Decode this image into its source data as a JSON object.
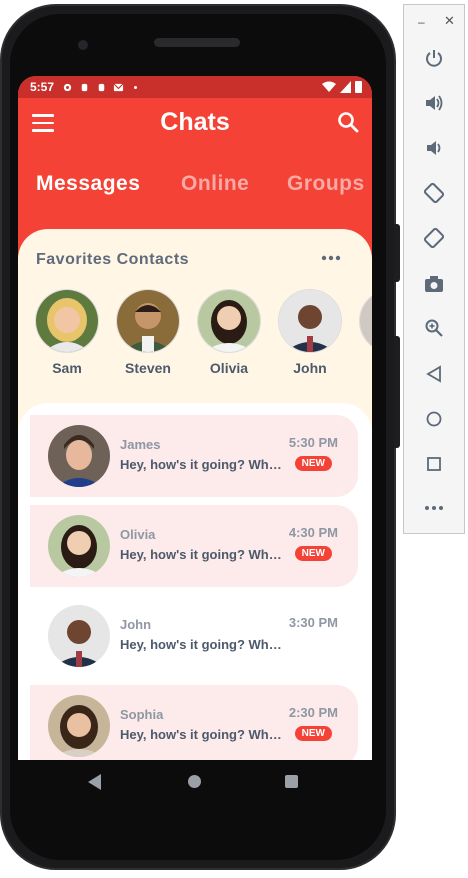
{
  "status_bar": {
    "time": "5:57"
  },
  "app_bar": {
    "title": "Chats"
  },
  "tabs": [
    {
      "label": "Messages",
      "active": true
    },
    {
      "label": "Online",
      "active": false
    },
    {
      "label": "Groups",
      "active": false
    }
  ],
  "favorites": {
    "title": "Favorites Contacts",
    "contacts": [
      {
        "name": "Sam"
      },
      {
        "name": "Steven"
      },
      {
        "name": "Olivia"
      },
      {
        "name": "John"
      }
    ]
  },
  "chats": [
    {
      "name": "James",
      "message": "Hey, how's it going? What did you do today?",
      "time": "5:30 PM",
      "unread": true,
      "badge": "NEW"
    },
    {
      "name": "Olivia",
      "message": "Hey, how's it going? What did you do today?",
      "time": "4:30 PM",
      "unread": true,
      "badge": "NEW"
    },
    {
      "name": "John",
      "message": "Hey, how's it going? What did you do today?",
      "time": "3:30 PM",
      "unread": false,
      "badge": ""
    },
    {
      "name": "Sophia",
      "message": "Hey, how's it going? What did you do today?",
      "time": "2:30 PM",
      "unread": true,
      "badge": "NEW"
    }
  ],
  "colors": {
    "primary": "#f44336",
    "status_bar": "#c9302c",
    "sheet": "#fff6e5",
    "unread_row": "#fdeaea"
  },
  "emulator_toolbar": {
    "buttons": [
      "power-icon",
      "volume-up-icon",
      "volume-down-icon",
      "rotate-left-icon",
      "rotate-right-icon",
      "camera-icon",
      "zoom-icon",
      "back-icon",
      "home-icon",
      "overview-icon",
      "more-icon"
    ]
  }
}
